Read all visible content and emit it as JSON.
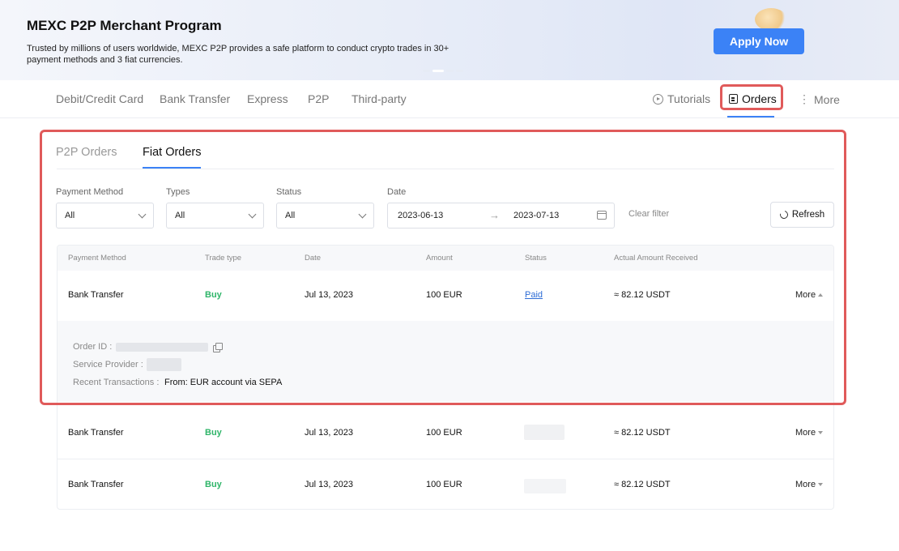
{
  "banner": {
    "title": "MEXC P2P Merchant Program",
    "description": "Trusted by millions of users worldwide, MEXC P2P provides a safe platform to conduct crypto trades in 30+ payment methods and 3 fiat currencies.",
    "apply_button": "Apply Now"
  },
  "nav": {
    "items": [
      "Debit/Credit Card",
      "Bank Transfer",
      "Express",
      "P2P",
      "Third-party"
    ],
    "tutorials": "Tutorials",
    "orders": "Orders",
    "more": "More"
  },
  "orders_panel": {
    "tabs": [
      "P2P Orders",
      "Fiat Orders"
    ],
    "active_tab": "Fiat Orders",
    "filters": {
      "payment_method_label": "Payment Method",
      "payment_method_value": "All",
      "types_label": "Types",
      "types_value": "All",
      "status_label": "Status",
      "status_value": "All",
      "date_label": "Date",
      "date_start": "2023-06-13",
      "date_arrow": "→",
      "date_end": "2023-07-13",
      "clear_filter": "Clear filter",
      "refresh": "Refresh"
    },
    "table": {
      "columns": [
        "Payment Method",
        "Trade type",
        "Date",
        "Amount",
        "Status",
        "Actual Amount Received"
      ],
      "rows": [
        {
          "payment_method": "Bank Transfer",
          "trade_type": "Buy",
          "date": "Jul 13, 2023",
          "amount": "100 EUR",
          "status": "Paid",
          "received": "≈ 82.12 USDT",
          "more": "More",
          "expanded": true
        },
        {
          "payment_method": "Bank Transfer",
          "trade_type": "Buy",
          "date": "Jul 13, 2023",
          "amount": "100 EUR",
          "status": "",
          "received": "≈ 82.12 USDT",
          "more": "More",
          "expanded": false
        },
        {
          "payment_method": "Bank Transfer",
          "trade_type": "Buy",
          "date": "Jul 13, 2023",
          "amount": "100 EUR",
          "status": "",
          "received": "≈ 82.12 USDT",
          "more": "More",
          "expanded": false
        }
      ],
      "details": {
        "order_id_label": "Order ID :",
        "service_provider_label": "Service Provider :",
        "recent_transactions_label": "Recent Transactions :",
        "recent_transactions_value": "From: EUR account via SEPA"
      }
    }
  },
  "colors": {
    "accent": "#3b82f6",
    "highlight_border": "#e05a5a",
    "buy": "#2fb569",
    "link": "#2e6dd6"
  }
}
